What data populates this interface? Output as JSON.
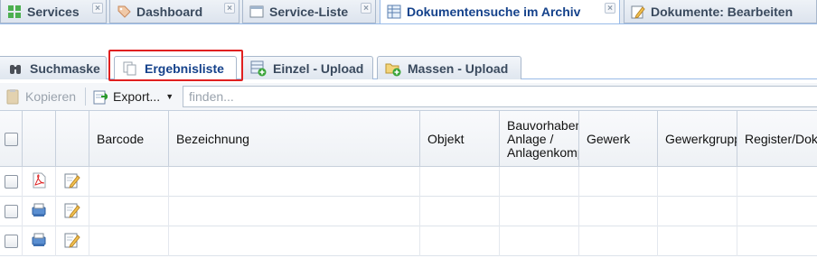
{
  "top_tabs": [
    {
      "label": "Services"
    },
    {
      "label": "Dashboard"
    },
    {
      "label": "Service-Liste"
    },
    {
      "label": "Dokumentensuche im Archiv"
    },
    {
      "label": "Dokumente: Bearbeiten"
    }
  ],
  "sub_tabs": [
    {
      "label": "Suchmaske"
    },
    {
      "label": "Ergebnisliste"
    },
    {
      "label": "Einzel - Upload"
    },
    {
      "label": "Massen - Upload"
    }
  ],
  "toolbar": {
    "copy_label": "Kopieren",
    "export_label": "Export...",
    "search_placeholder": "finden..."
  },
  "grid": {
    "columns": [
      {
        "label": ""
      },
      {
        "label": ""
      },
      {
        "label": ""
      },
      {
        "label": "Barcode"
      },
      {
        "label": "Bezeichnung"
      },
      {
        "label": "Objekt"
      },
      {
        "label": "Bauvorhaben Anlage / Anlagenkomponente"
      },
      {
        "label": "Gewerk"
      },
      {
        "label": "Gewerkgruppe"
      },
      {
        "label": "Register/Dokumentenart"
      }
    ],
    "rows": [
      {
        "type_icon": "pdf-icon",
        "edit_icon": "pencil-icon"
      },
      {
        "type_icon": "scanner-icon",
        "edit_icon": "pencil-icon"
      },
      {
        "type_icon": "scanner-icon",
        "edit_icon": "pencil-icon"
      }
    ]
  },
  "colors": {
    "active_tab_text": "#15428b",
    "highlight_border": "#e02020",
    "tab_border": "#99bbe8"
  }
}
